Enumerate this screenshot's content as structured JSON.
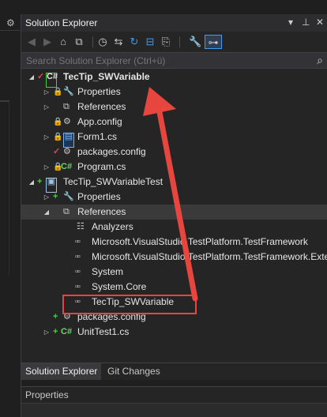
{
  "left_strip": {
    "gear_icon": "gear-icon"
  },
  "panel": {
    "title": "Solution Explorer",
    "title_controls": {
      "dropdown": "chevron-down-icon",
      "pin": "pin-icon",
      "close": "close-icon"
    }
  },
  "toolbar": {
    "icons": [
      "back-icon",
      "forward-icon",
      "home-icon",
      "switch-views-icon",
      "history-icon",
      "sync-icon",
      "refresh-icon",
      "collapse-all-icon",
      "show-all-files-icon",
      "properties-icon",
      "preview-icon"
    ]
  },
  "search": {
    "placeholder": "Search Solution Explorer (Ctrl+ü)"
  },
  "tree": [
    {
      "label": "TecTip_SWVariable",
      "kind": "project",
      "bold": true,
      "expander": "expanded",
      "status": "red-check"
    },
    {
      "label": "Properties",
      "kind": "properties",
      "expander": "collapsed",
      "status": "lock"
    },
    {
      "label": "References",
      "kind": "references",
      "expander": "collapsed"
    },
    {
      "label": "App.config",
      "kind": "config",
      "status": "lock"
    },
    {
      "label": "Form1.cs",
      "kind": "form",
      "expander": "collapsed",
      "status": "lock"
    },
    {
      "label": "packages.config",
      "kind": "config",
      "status": "red-check"
    },
    {
      "label": "Program.cs",
      "kind": "csharp",
      "expander": "collapsed",
      "status": "lock"
    },
    {
      "label": "TecTip_SWVariableTest",
      "kind": "project",
      "expander": "expanded",
      "status": "green-plus"
    },
    {
      "label": "Properties",
      "kind": "properties",
      "expander": "collapsed",
      "status": "green-plus"
    },
    {
      "label": "References",
      "kind": "references",
      "expander": "expanded",
      "selected": true
    },
    {
      "label": "Analyzers",
      "kind": "analyzers"
    },
    {
      "label": "Microsoft.VisualStudio.TestPlatform.TestFramework",
      "kind": "assembly"
    },
    {
      "label": "Microsoft.VisualStudio.TestPlatform.TestFramework.Exte",
      "kind": "assembly"
    },
    {
      "label": "System",
      "kind": "assembly"
    },
    {
      "label": "System.Core",
      "kind": "assembly"
    },
    {
      "label": "TecTip_SWVariable",
      "kind": "assembly",
      "highlighted": true
    },
    {
      "label": "packages.config",
      "kind": "config",
      "status": "green-plus"
    },
    {
      "label": "UnitTest1.cs",
      "kind": "csharp",
      "expander": "collapsed",
      "status": "green-plus"
    }
  ],
  "tabs": [
    {
      "label": "Solution Explorer",
      "active": true
    },
    {
      "label": "Git Changes",
      "active": false
    }
  ],
  "properties_panel": {
    "title": "Properties"
  },
  "colors": {
    "accent": "#3d9bf2",
    "highlight_box": "#e6463e",
    "arrow": "#e6463e",
    "background": "#252526"
  }
}
